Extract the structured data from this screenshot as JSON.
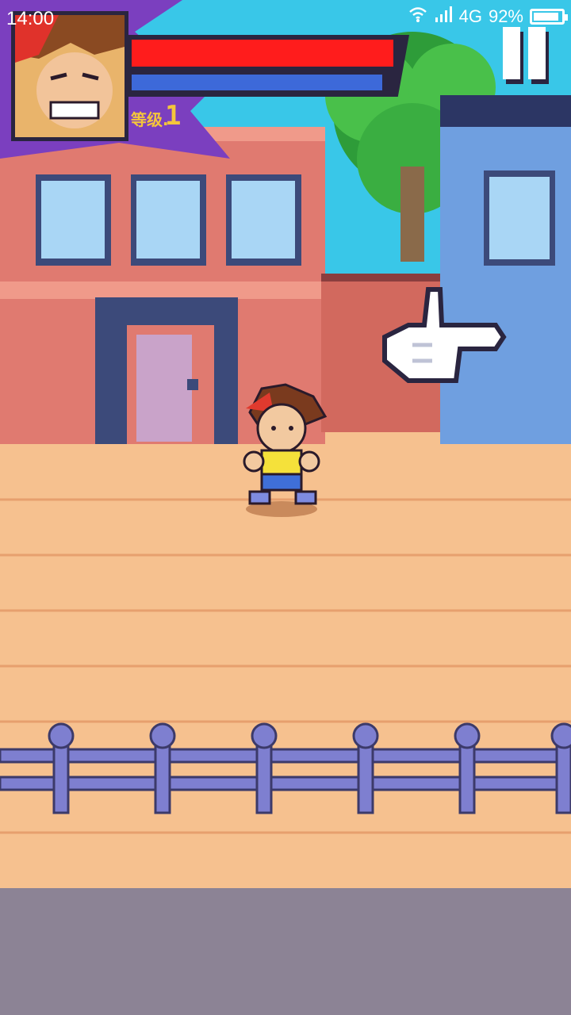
{
  "status_bar": {
    "time": "14:00",
    "network": "4G",
    "battery_text": "92%",
    "battery_level": 0.92
  },
  "hud": {
    "level_label": "等级.",
    "level_value": "1",
    "hp_fraction": 1.0,
    "mp_fraction": 1.0,
    "pause_icon": "pause-icon"
  },
  "colors": {
    "hp": "#ff1c1c",
    "mp": "#3d69d9",
    "level_text": "#f4c53c",
    "hud_purple": "#7b3fbf"
  },
  "scene": {
    "pointer_icon": "pointing-hand-icon"
  }
}
